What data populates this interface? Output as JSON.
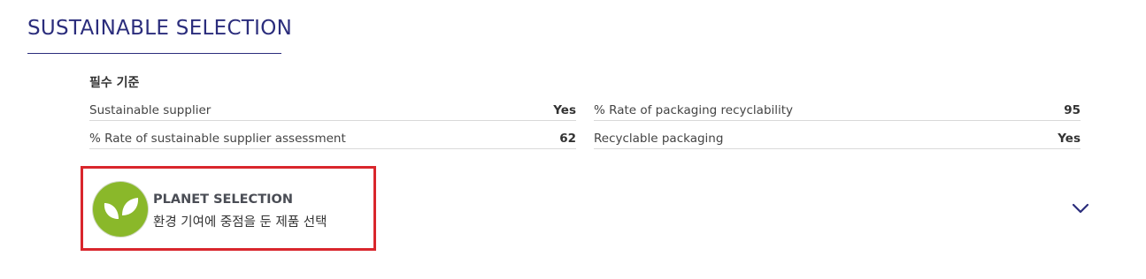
{
  "section": {
    "title": "SUSTAINABLE SELECTION",
    "criteria_label": "필수 기준"
  },
  "criteria": {
    "left": [
      {
        "label": "Sustainable supplier",
        "value": "Yes"
      },
      {
        "label": "% Rate of sustainable supplier assessment",
        "value": "62"
      }
    ],
    "right": [
      {
        "label": "% Rate of packaging recyclability",
        "value": "95"
      },
      {
        "label": "Recyclable packaging",
        "value": "Yes"
      }
    ]
  },
  "planet": {
    "title": "PLANET SELECTION",
    "subtitle": "환경 기여에 중점을 둔 제품 선택",
    "icon": "leaf-icon"
  },
  "colors": {
    "title": "#2b2d7c",
    "leaf_bg": "#8ab82a",
    "highlight_border": "#d9262c"
  }
}
